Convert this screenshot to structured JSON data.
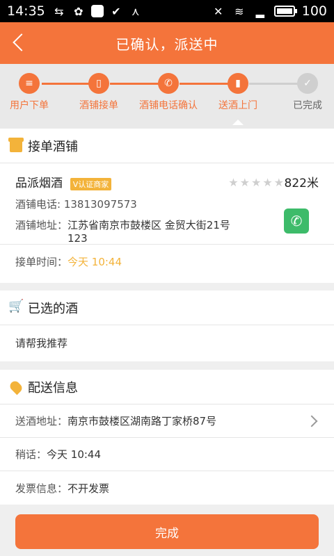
{
  "status_bar": {
    "time": "14:35",
    "battery": "100"
  },
  "header": {
    "title": "已确认，派送中"
  },
  "steps": [
    {
      "label": "用户下单"
    },
    {
      "label": "酒铺接单"
    },
    {
      "label": "酒铺电话确认"
    },
    {
      "label": "送酒上门"
    },
    {
      "label": "已完成"
    }
  ],
  "shop_section": {
    "title": "接单酒铺",
    "shop_name": "品派烟酒",
    "badge": "V认证商家",
    "distance": "822米",
    "phone_label": "酒铺电话:",
    "phone": "13813097573",
    "address_label": "酒铺地址：",
    "address_line1": "江苏省南京市鼓楼区 金贸大街21号",
    "address_line2": "123",
    "time_label": "接单时间：",
    "time_value": "今天 10:44"
  },
  "wine_section": {
    "title": "已选的酒",
    "content": "请帮我推荐"
  },
  "delivery_section": {
    "title": "配送信息",
    "address_label": "送酒地址：",
    "address": "南京市鼓楼区湖南路丁家桥87号",
    "note_label": "稍话：",
    "note": "今天 10:44",
    "invoice_label": "发票信息：",
    "invoice": "不开发票"
  },
  "footer": {
    "complete_label": "完成"
  },
  "colors": {
    "accent": "#f4743b",
    "gold": "#f3b33a",
    "green": "#3dbb6a"
  }
}
